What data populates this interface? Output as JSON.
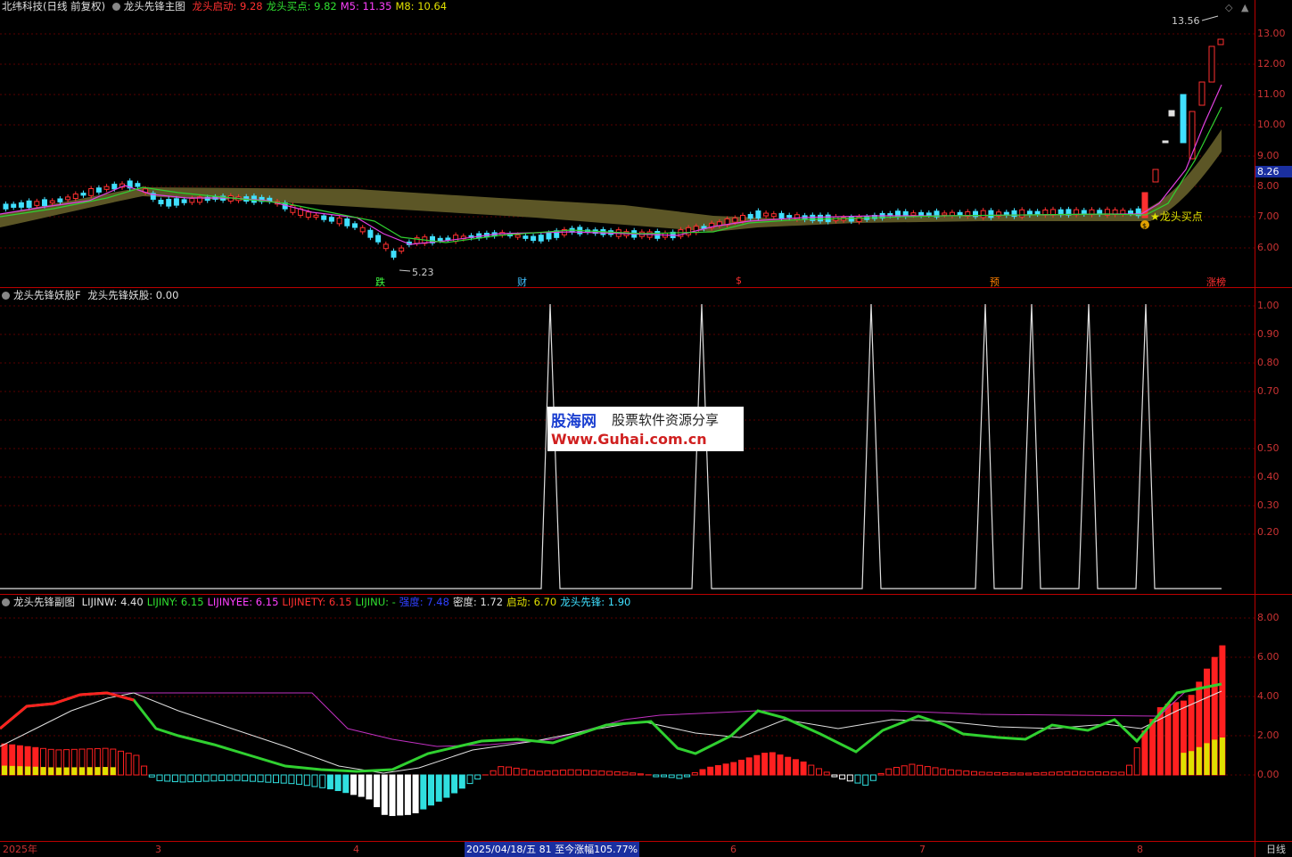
{
  "main": {
    "title": "北纬科技(日线 前复权)",
    "indicator": "龙头先锋主图",
    "vals": [
      {
        "t": "龙头启动: 9.28",
        "c": "#ff3030"
      },
      {
        "t": "龙头买点: 9.82",
        "c": "#30e030"
      },
      {
        "t": "M5: 11.35",
        "c": "#ff40ff"
      },
      {
        "t": "M8: 10.64",
        "c": "#e0e000"
      }
    ],
    "y_labels": [
      "13.00",
      "12.00",
      "11.00",
      "10.00",
      "9.00",
      "8.00",
      "7.00",
      "6.00"
    ],
    "price_tag": "8.26",
    "high_label": "13.56",
    "low_label": "5.23",
    "buy_label": "★龙头买点",
    "markers": [
      {
        "t": "跌",
        "c": "#40ff40"
      },
      {
        "t": "财",
        "c": "#40c0ff"
      },
      {
        "t": "$",
        "c": "#ff3030"
      },
      {
        "t": "预",
        "c": "#ff8000"
      },
      {
        "t": "涨榜",
        "c": "#ff3030"
      }
    ]
  },
  "sub1": {
    "title": "龙头先锋妖股F",
    "value": "龙头先锋妖股: 0.00",
    "y_labels": [
      "1.00",
      "0.90",
      "0.80",
      "0.70",
      "0.50",
      "0.40",
      "0.30",
      "0.20"
    ]
  },
  "sub2": {
    "title": "龙头先锋副图",
    "vals": [
      {
        "t": "LIJINW: 4.40",
        "c": "#e0e0e0"
      },
      {
        "t": "LIJINY: 6.15",
        "c": "#30e030"
      },
      {
        "t": "LIJINYEE: 6.15",
        "c": "#ff40ff"
      },
      {
        "t": "LIJINETY: 6.15",
        "c": "#ff3030"
      },
      {
        "t": "LIJINU: -",
        "c": "#30e030"
      },
      {
        "t": "强度: 7.48",
        "c": "#3040ff"
      },
      {
        "t": "密度: 1.72",
        "c": "#e0e0e0"
      },
      {
        "t": "启动: 6.70",
        "c": "#e0e000"
      },
      {
        "t": "龙头先锋: 1.90",
        "c": "#40e0ff"
      }
    ],
    "y_labels": [
      "8.00",
      "6.00",
      "4.00",
      "2.00",
      "0.00"
    ]
  },
  "dates": {
    "year": "2025年",
    "m3": "3",
    "m4": "4",
    "info": "2025/04/18/五 81 至今涨幅105.77%",
    "m6": "6",
    "m7": "7",
    "m8": "8",
    "period": "日线"
  },
  "watermark": {
    "logo": "股海网",
    "tagline": "股票软件资源分享",
    "url": "Www.Guhai.com.cn"
  }
}
